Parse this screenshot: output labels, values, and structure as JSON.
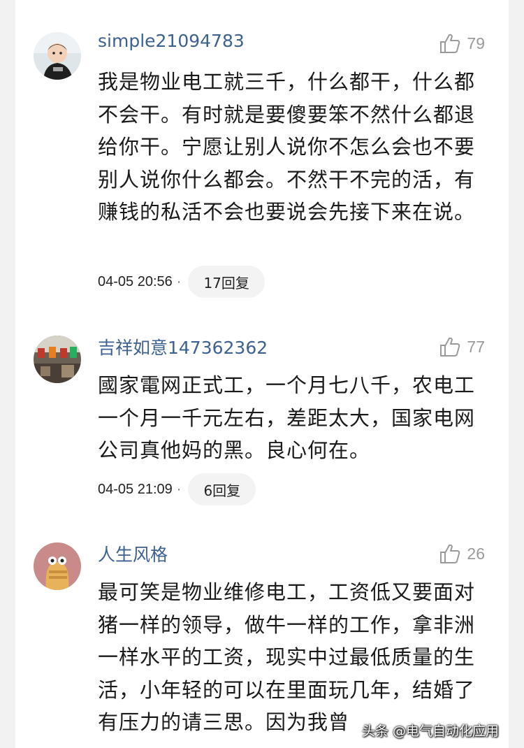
{
  "comments": [
    {
      "username": "simple21094783",
      "likes": "79",
      "text": "我是物业电工就三千，什么都干，什么都不会干。有时就是要傻要笨不然什么都退给你干。宁愿让别人说你不怎么会也不要别人说你什么都会。不然干不完的活，有赚钱的私活不会也要说会先接下来在说。",
      "time": "04-05 20:56",
      "separator": "·",
      "replies": "17回复"
    },
    {
      "username": "吉祥如意147362362",
      "likes": "77",
      "text": "國家電网正式工，一个月七八千，农电工一个月一千元左右，差距太大，国家电网公司真他妈的黑。良心何在。",
      "time": "04-05 21:09",
      "separator": "·",
      "replies": "6回复"
    },
    {
      "username": "人生风格",
      "likes": "26",
      "text": "最可笑是物业维修电工，工资低又要面对猪一样的领导，做牛一样的工作，拿非洲一样水平的工资，现实中过最低质量的生活，小年轻的可以在里面玩几年，结婚了有压力的请三思。因为我曾"
    }
  ],
  "watermark": "头条 @电气自动化应用",
  "icons": [
    "thumbs-up-icon"
  ],
  "colors": {
    "username": "#3d6190",
    "likes": "#9a9a9a",
    "background": "#f2f2f2"
  }
}
